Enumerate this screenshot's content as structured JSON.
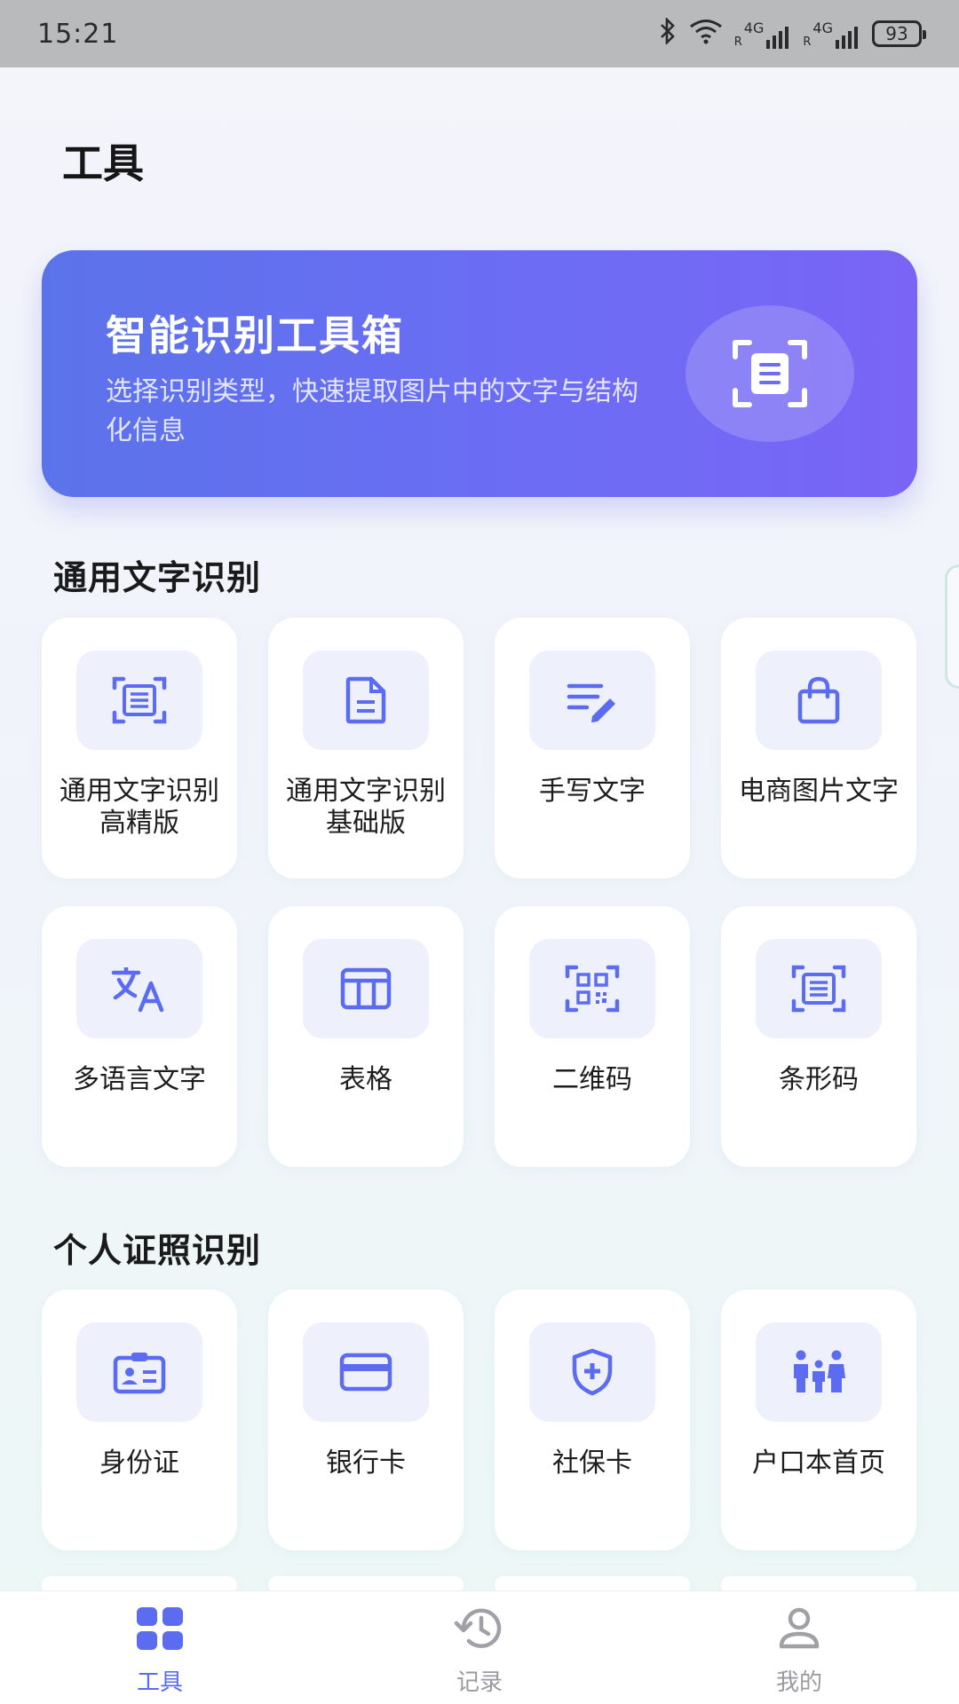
{
  "status_bar": {
    "time": "15:21",
    "signal1": "4G",
    "signal2": "4G",
    "battery": "93"
  },
  "page_title": "工具",
  "banner": {
    "title": "智能识别工具箱",
    "subtitle": "选择识别类型，快速提取图片中的文字与结构化信息",
    "icon": "scan-document-icon"
  },
  "sections": [
    {
      "title": "通用文字识别",
      "items": [
        {
          "label": "通用文字识别高精版",
          "icon": "scan-text-icon"
        },
        {
          "label": "通用文字识别基础版",
          "icon": "document-icon"
        },
        {
          "label": "手写文字",
          "icon": "handwriting-icon"
        },
        {
          "label": "电商图片文字",
          "icon": "shopping-bag-icon"
        },
        {
          "label": "多语言文字",
          "icon": "translate-icon"
        },
        {
          "label": "表格",
          "icon": "table-icon"
        },
        {
          "label": "二维码",
          "icon": "qr-code-icon"
        },
        {
          "label": "条形码",
          "icon": "barcode-scan-icon"
        }
      ]
    },
    {
      "title": "个人证照识别",
      "items": [
        {
          "label": "身份证",
          "icon": "id-card-icon"
        },
        {
          "label": "银行卡",
          "icon": "bank-card-icon"
        },
        {
          "label": "社保卡",
          "icon": "shield-plus-icon"
        },
        {
          "label": "户口本首页",
          "icon": "family-icon"
        }
      ]
    }
  ],
  "tab_bar": {
    "tabs": [
      {
        "label": "工具",
        "icon": "grid-icon",
        "active": true
      },
      {
        "label": "记录",
        "icon": "history-icon",
        "active": false
      },
      {
        "label": "我的",
        "icon": "user-icon",
        "active": false
      }
    ]
  },
  "colors": {
    "accent": "#5b6cf0",
    "banner_start": "#5b73ea",
    "banner_end": "#7a64f6",
    "icon_bg": "#eef0fc",
    "inactive": "#9a9aa0"
  }
}
